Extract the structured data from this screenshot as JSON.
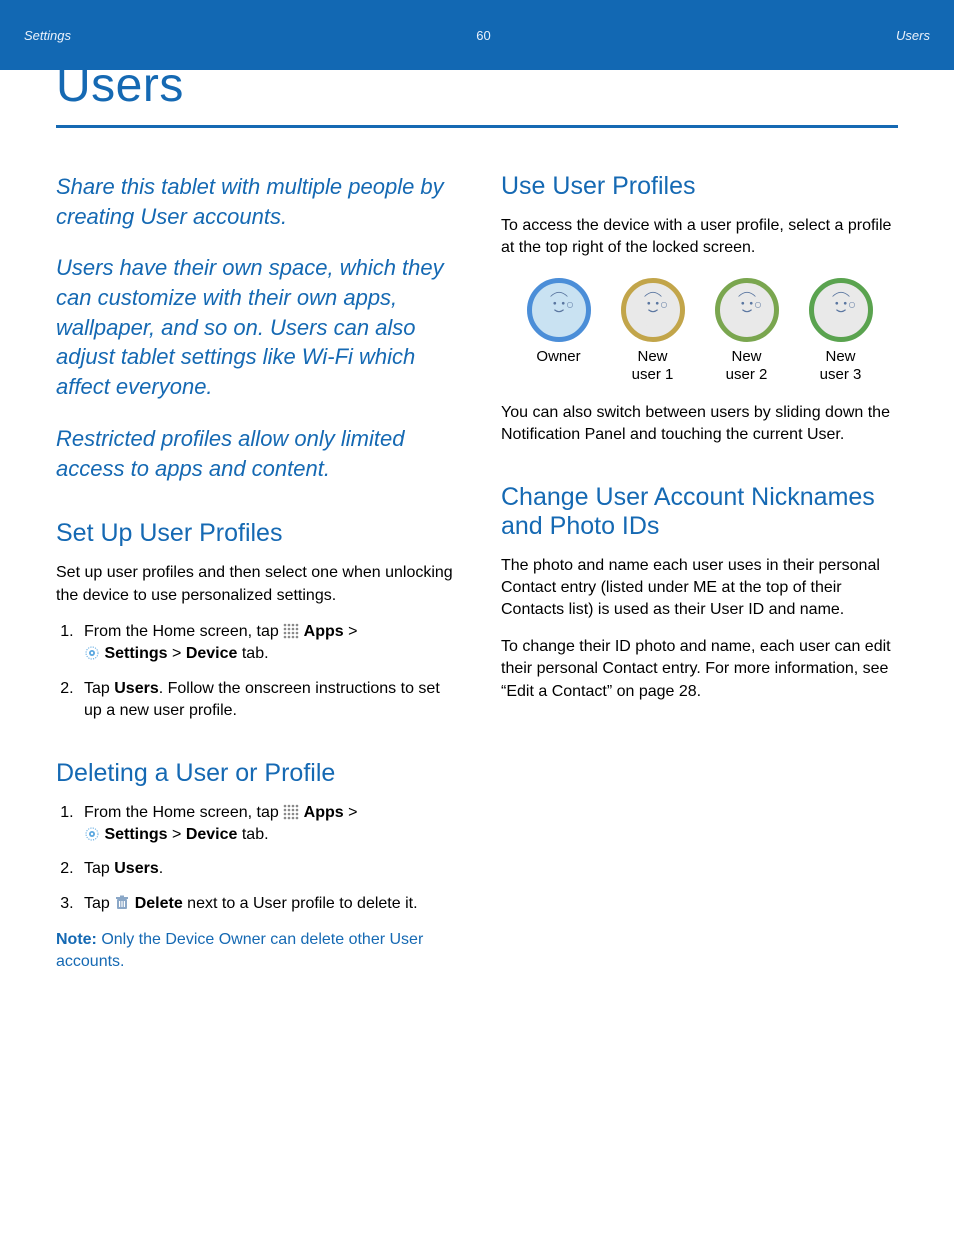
{
  "title": "Users",
  "intro": {
    "p1": "Share this tablet with multiple people by creating User accounts.",
    "p2": "Users have their own space, which they can customize with their own apps, wallpaper, and so on. Users can also adjust tablet settings like Wi-Fi which affect everyone.",
    "p3": "Restricted profiles allow only limited access to apps and content."
  },
  "setup": {
    "heading": "Set Up User Profiles",
    "lead": "Set up user profiles and then select one when unlocking the device to use personalized settings.",
    "step1_a": "From the Home screen, tap ",
    "apps_label": "Apps",
    "gt": " > ",
    "settings_label": "Settings",
    "device_label": "Device",
    "tab_suffix": " tab.",
    "step2_a": "Tap ",
    "users_label": "Users",
    "step2_b": ". Follow the onscreen instructions to set up a new user profile."
  },
  "delete": {
    "heading": "Deleting a User or Profile",
    "step1_a": "From the Home screen, tap ",
    "step2_a": "Tap ",
    "step2_b": ".",
    "step3_a": "Tap ",
    "delete_label": "Delete",
    "step3_b": " next to a User profile to delete it.",
    "note_label": "Note:",
    "note_text": " Only the Device Owner can delete other User accounts."
  },
  "use": {
    "heading": "Use User Profiles",
    "p1": "To access the device with a user profile, select a profile at the top right of the locked screen.",
    "p2": "You can also switch between users by sliding down the Notification Panel and touching the current User.",
    "profiles": [
      {
        "label": "Owner",
        "ring": "#4b8ed8",
        "face": "#c9e2f2"
      },
      {
        "label": "New\nuser 1",
        "ring": "#c2a54a",
        "face": "#e9e9e9"
      },
      {
        "label": "New\nuser 2",
        "ring": "#7aa64f",
        "face": "#e9e9e9"
      },
      {
        "label": "New\nuser 3",
        "ring": "#5aa34f",
        "face": "#e9e9e9"
      }
    ]
  },
  "change": {
    "heading": "Change User Account Nicknames and Photo IDs",
    "p1": "The photo and name each user uses in their personal Contact entry (listed under ME at the top of their Contacts list) is used as their User ID and name.",
    "p2": "To change their ID photo and name, each user can edit their personal Contact entry. For more information, see “Edit a Contact” on page 28."
  },
  "footer": {
    "left": "Settings",
    "page": "60",
    "right": "Users"
  }
}
